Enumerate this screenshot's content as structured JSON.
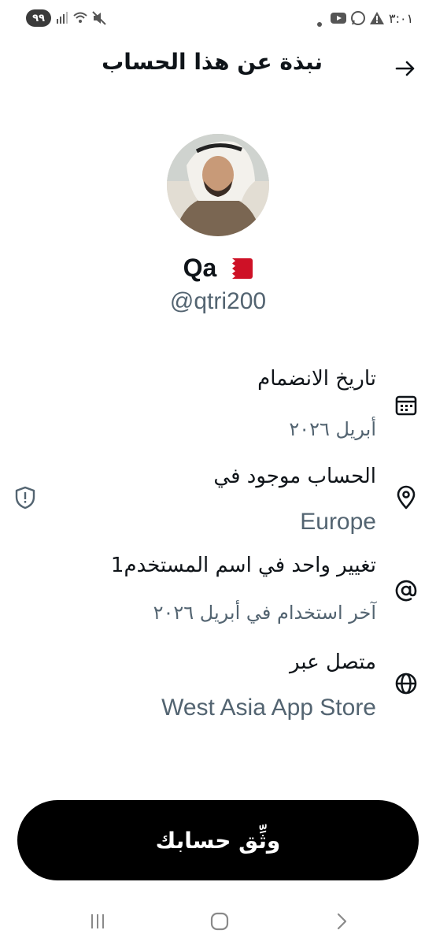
{
  "status_bar": {
    "time": "٣:٠١",
    "battery": "٩٩",
    "left_icons": [
      "signal-icon",
      "wifi-icon",
      "mute-icon"
    ],
    "right_icons": [
      "dot-icon",
      "youtube-icon",
      "whatsapp-icon",
      "warning-icon"
    ]
  },
  "header": {
    "title": "نبذة عن هذا الحساب",
    "back_icon": "arrow-right-icon"
  },
  "profile": {
    "name": "Qa",
    "handle": "@qtri200",
    "flag": "bahrain-flag"
  },
  "info": {
    "joined_label": "تاريخ الانضمام",
    "joined_value": "أبريل ٢٠٢٦",
    "location_label": "الحساب موجود في",
    "location_value": "Europe",
    "username_label": "تغيير واحد في اسم المستخدم1",
    "username_value": "آخر استخدام في أبريل ٢٠٢٦",
    "connected_label": "متصل عبر",
    "connected_value": "West Asia App Store"
  },
  "verify_button": "وثِّق حسابك",
  "colors": {
    "text_primary": "#0f1419",
    "text_secondary": "#536471",
    "button_bg": "#000000"
  }
}
